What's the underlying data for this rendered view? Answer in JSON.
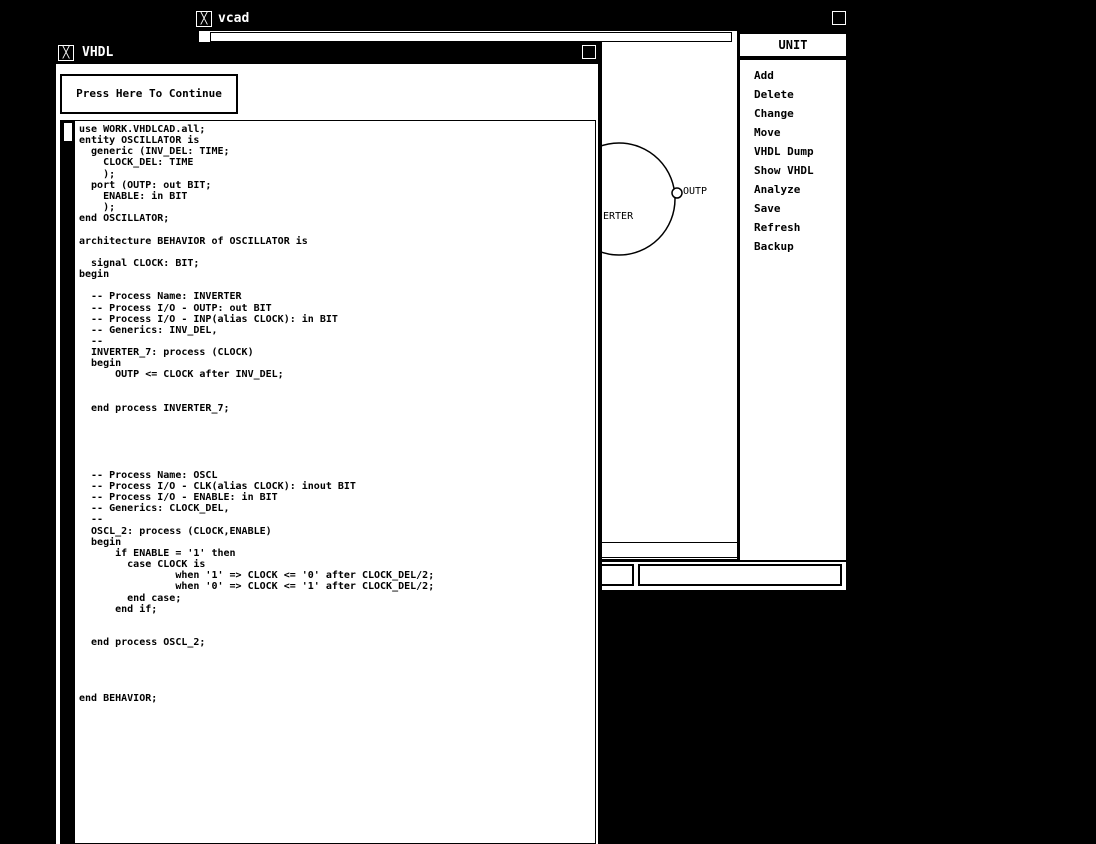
{
  "vcad_window": {
    "title": "vcad",
    "menu_header": "UNIT",
    "menu_items": [
      "Add",
      "Delete",
      "Change",
      "Move",
      "VHDL Dump",
      "Show VHDL",
      "Analyze",
      "Save",
      "Refresh",
      "Backup"
    ],
    "diagram": {
      "component_label": "ERTER",
      "port_label": "OUTP"
    }
  },
  "vhdl_window": {
    "title": "VHDL",
    "continue_button": "Press Here To Continue",
    "code": "use WORK.VHDLCAD.all;\nentity OSCILLATOR is\n  generic (INV_DEL: TIME;\n    CLOCK_DEL: TIME\n    );\n  port (OUTP: out BIT;\n    ENABLE: in BIT\n    );\nend OSCILLATOR;\n\narchitecture BEHAVIOR of OSCILLATOR is\n\n  signal CLOCK: BIT;\nbegin\n\n  -- Process Name: INVERTER\n  -- Process I/O - OUTP: out BIT\n  -- Process I/O - INP(alias CLOCK): in BIT\n  -- Generics: INV_DEL,\n  --\n  INVERTER_7: process (CLOCK)\n  begin\n      OUTP <= CLOCK after INV_DEL;\n\n\n  end process INVERTER_7;\n\n\n\n\n\n  -- Process Name: OSCL\n  -- Process I/O - CLK(alias CLOCK): inout BIT\n  -- Process I/O - ENABLE: in BIT\n  -- Generics: CLOCK_DEL,\n  --\n  OSCL_2: process (CLOCK,ENABLE)\n  begin\n      if ENABLE = '1' then\n        case CLOCK is\n                when '1' => CLOCK <= '0' after CLOCK_DEL/2;\n                when '0' => CLOCK <= '1' after CLOCK_DEL/2;\n        end case;\n      end if;\n\n\n  end process OSCL_2;\n\n\n\n\nend BEHAVIOR;"
  },
  "colors": {
    "background": "#000000",
    "window": "#ffffff",
    "text": "#000000"
  }
}
